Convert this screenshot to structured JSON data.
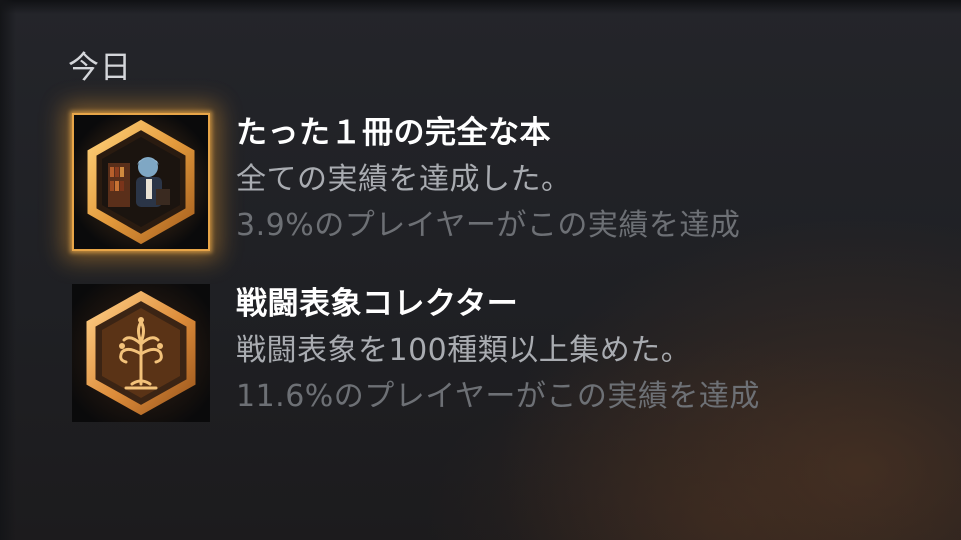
{
  "section": {
    "title": "今日"
  },
  "achievements": [
    {
      "name": "たった１冊の完全な本",
      "description": "全ての実績を達成した。",
      "stat": "3.9%のプレイヤーがこの実績を達成",
      "icon": "hexagon-character-badge-icon",
      "highlighted": true,
      "accent": "#e7a548"
    },
    {
      "name": "戦闘表象コレクター",
      "description": "戦闘表象を100種類以上集めた。",
      "stat": "11.6%のプレイヤーがこの実績を達成",
      "icon": "hexagon-tree-badge-icon",
      "highlighted": false,
      "accent": "#d98a3a"
    }
  ],
  "colors": {
    "background": "#1f2024",
    "name": "#ffffff",
    "description": "#a9acb1",
    "stat": "#6d7075",
    "gold": "#e7a548"
  }
}
